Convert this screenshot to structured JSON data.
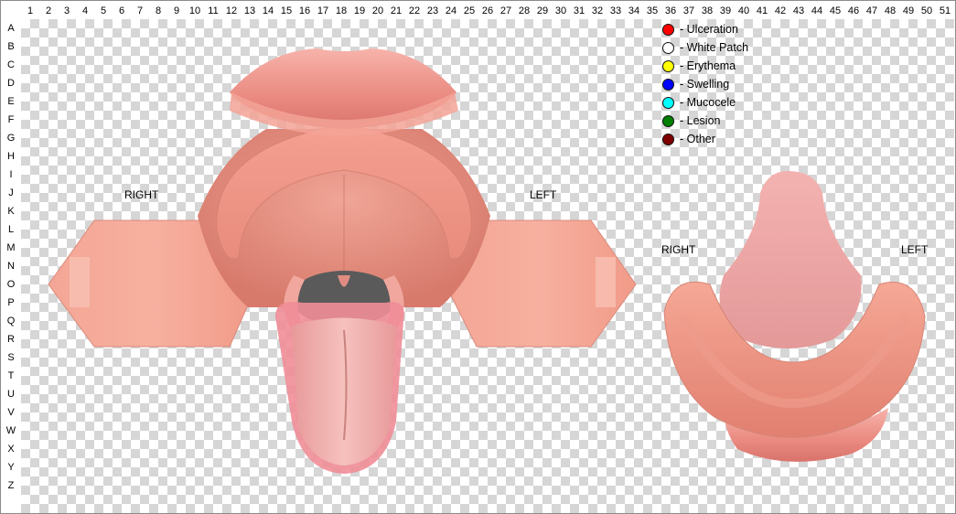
{
  "columns": [
    "1",
    "2",
    "3",
    "4",
    "5",
    "6",
    "7",
    "8",
    "9",
    "10",
    "11",
    "12",
    "13",
    "14",
    "15",
    "16",
    "17",
    "18",
    "19",
    "20",
    "21",
    "22",
    "23",
    "24",
    "25",
    "26",
    "27",
    "28",
    "29",
    "30",
    "31",
    "32",
    "33",
    "34",
    "35",
    "36",
    "37",
    "38",
    "39",
    "40",
    "41",
    "42",
    "43",
    "44",
    "45",
    "46",
    "47",
    "48",
    "49",
    "50",
    "51"
  ],
  "rows": [
    "A",
    "B",
    "C",
    "D",
    "E",
    "F",
    "G",
    "H",
    "I",
    "J",
    "K",
    "L",
    "M",
    "N",
    "O",
    "P",
    "Q",
    "R",
    "S",
    "T",
    "U",
    "V",
    "W",
    "X",
    "Y",
    "Z"
  ],
  "labels": {
    "upper_right": "RIGHT",
    "upper_left": "LEFT",
    "lower_right": "RIGHT",
    "lower_left": "LEFT"
  },
  "legend": [
    {
      "label": "- Ulceration",
      "color": "#ff0000"
    },
    {
      "label": "- White Patch",
      "color": "#ffffff"
    },
    {
      "label": "- Erythema",
      "color": "#ffff00"
    },
    {
      "label": "- Swelling",
      "color": "#0000ff"
    },
    {
      "label": "- Mucocele",
      "color": "#00ffff"
    },
    {
      "label": "- Lesion",
      "color": "#007f00"
    },
    {
      "label": "- Other",
      "color": "#7f0000"
    }
  ]
}
